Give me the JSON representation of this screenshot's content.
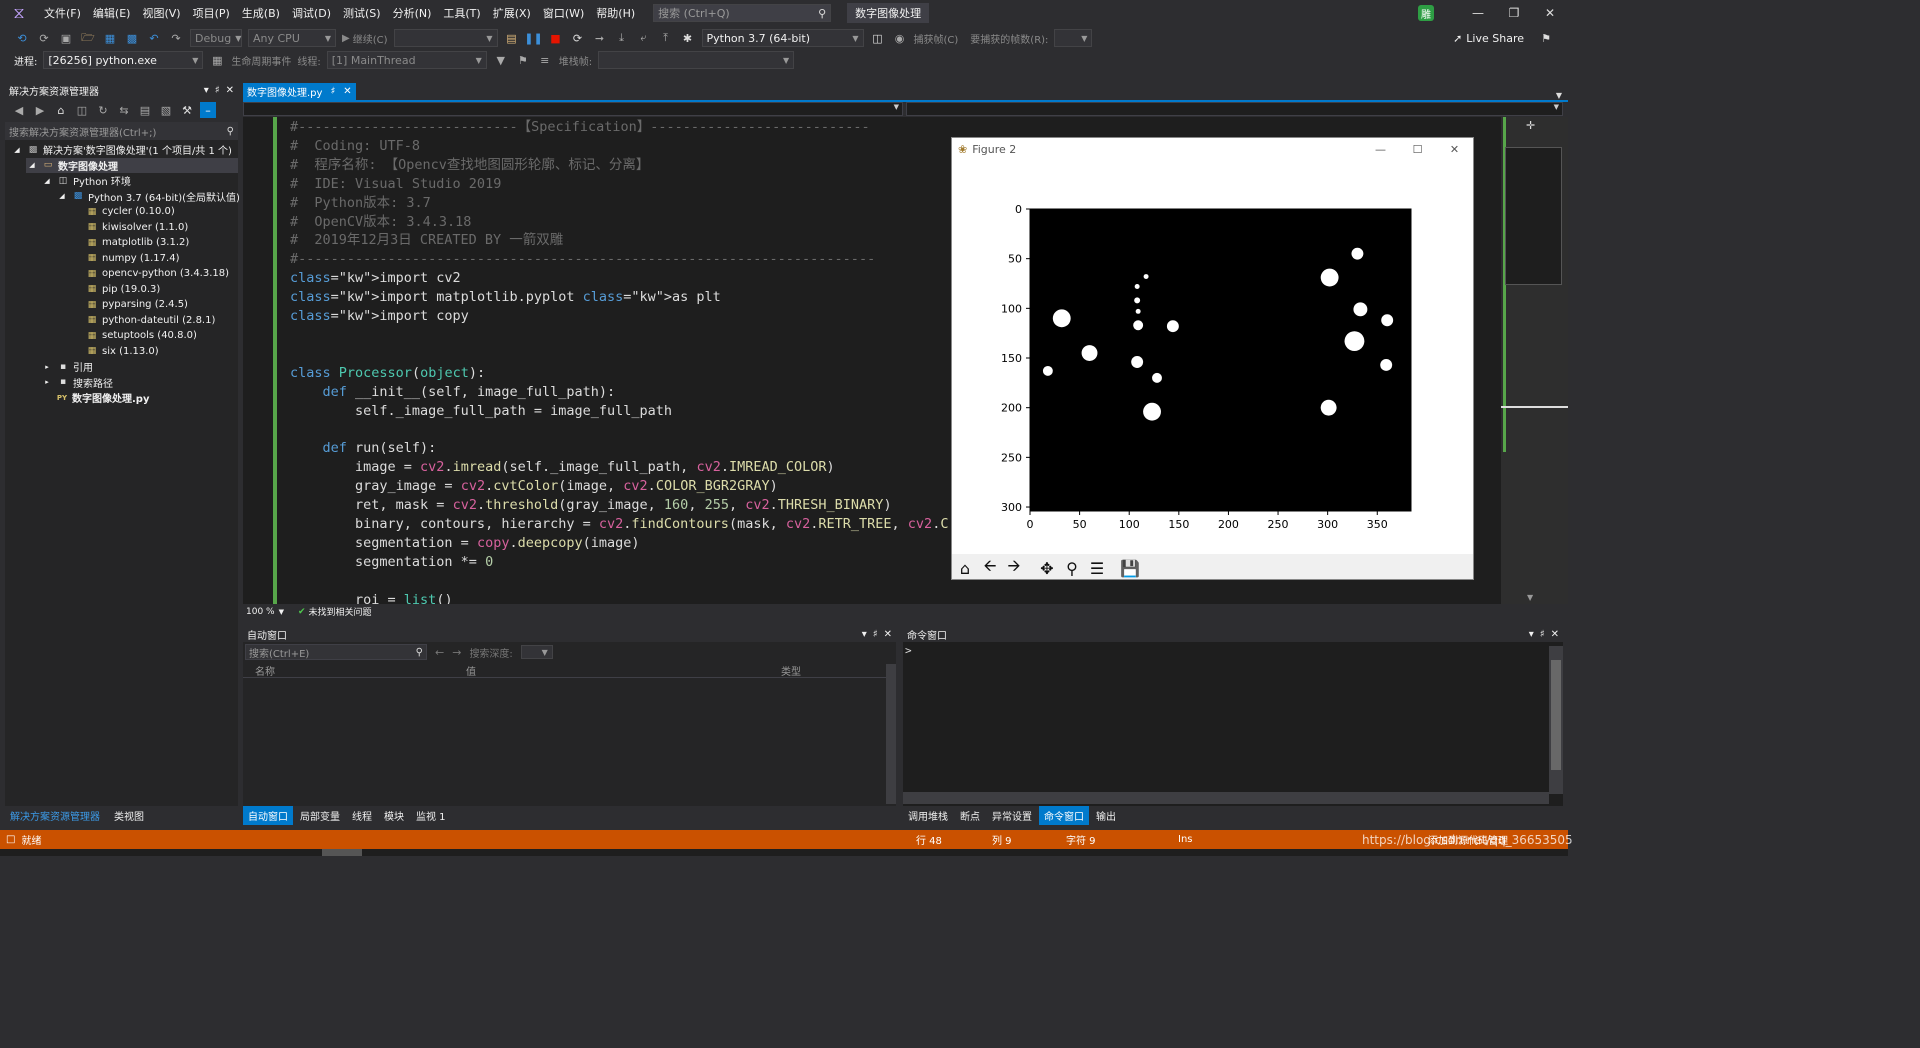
{
  "title_bar": {
    "menus": [
      "文件(F)",
      "编辑(E)",
      "视图(V)",
      "项目(P)",
      "生成(B)",
      "调试(D)",
      "测试(S)",
      "分析(N)",
      "工具(T)",
      "扩展(X)",
      "窗口(W)",
      "帮助(H)"
    ],
    "search_placeholder": "搜索 (Ctrl+Q)",
    "solution_name": "数字图像处理",
    "user_badge": "雕"
  },
  "toolbar1": {
    "config": "Debug",
    "platform": "Any CPU",
    "continue": "继续(C)",
    "python_env": "Python 3.7 (64-bit)",
    "capture": "捕获帧(C)",
    "frames_label": "要捕获的帧数(R):",
    "live_share": "Live Share"
  },
  "toolbar2": {
    "process_label": "进程:",
    "process_value": "[26256] python.exe",
    "lifecycle": "生命周期事件",
    "thread_label": "线程:",
    "thread_value": "[1] MainThread",
    "stack_label": "堆栈帧:"
  },
  "solution_explorer": {
    "title": "解决方案资源管理器",
    "search_placeholder": "搜索解决方案资源管理器(Ctrl+;)",
    "items": [
      {
        "label": "解决方案'数字图像处理'(1 个项目/共 1 个)",
        "icon": "solution-icon"
      },
      {
        "label": "数字图像处理",
        "icon": "python-project-icon"
      },
      {
        "label": "Python 环境",
        "icon": "environment-icon"
      },
      {
        "label": "Python 3.7 (64-bit)(全局默认值)",
        "icon": "python-env-icon"
      },
      {
        "label": "cycler (0.10.0)",
        "icon": "package-icon"
      },
      {
        "label": "kiwisolver (1.1.0)",
        "icon": "package-icon"
      },
      {
        "label": "matplotlib (3.1.2)",
        "icon": "package-icon"
      },
      {
        "label": "numpy (1.17.4)",
        "icon": "package-icon"
      },
      {
        "label": "opencv-python (3.4.3.18)",
        "icon": "package-icon"
      },
      {
        "label": "pip (19.0.3)",
        "icon": "package-icon"
      },
      {
        "label": "pyparsing (2.4.5)",
        "icon": "package-icon"
      },
      {
        "label": "python-dateutil (2.8.1)",
        "icon": "package-icon"
      },
      {
        "label": "setuptools (40.8.0)",
        "icon": "package-icon"
      },
      {
        "label": "six (1.13.0)",
        "icon": "package-icon"
      },
      {
        "label": "引用",
        "icon": "reference-icon"
      },
      {
        "label": "搜索路径",
        "icon": "search-path-icon"
      },
      {
        "label": "数字图像处理.py",
        "icon": "python-file-icon"
      }
    ],
    "bottom_tabs": [
      "解决方案资源管理器",
      "类视图"
    ]
  },
  "editor": {
    "tab_label": "数字图像处理.py",
    "zoom": "100 %",
    "issues": "未找到相关问题"
  },
  "code_lines": [
    "#---------------------------【Specification】---------------------------",
    "#  Coding: UTF-8",
    "#  程序名称: 【Opencv查找地图圆形轮廓、标记、分离】",
    "#  IDE: Visual Studio 2019",
    "#  Python版本: 3.7",
    "#  OpenCV版本: 3.4.3.18",
    "#  2019年12月3日 CREATED BY 一箭双雕",
    "#-----------------------------------------------------------------------",
    "import cv2",
    "import matplotlib.pyplot as plt",
    "import copy",
    "",
    "",
    "class Processor(object):",
    "    def __init__(self, image_full_path):",
    "        self._image_full_path = image_full_path",
    "",
    "    def run(self):",
    "        image = cv2.imread(self._image_full_path, cv2.IMREAD_COLOR)",
    "        gray_image = cv2.cvtColor(image, cv2.COLOR_BGR2GRAY)",
    "        ret, mask = cv2.threshold(gray_image, 160, 255, cv2.THRESH_BINARY)",
    "        binary, contours, hierarchy = cv2.findContours(mask, cv2.RETR_TREE, cv2.C",
    "        segmentation = copy.deepcopy(image)",
    "        segmentation *= 0",
    "",
    "        roi = list()"
  ],
  "figure": {
    "title": "Figure 2",
    "x_ticks": [
      "0",
      "50",
      "100",
      "150",
      "200",
      "250",
      "300",
      "350"
    ],
    "y_ticks": [
      "0",
      "50",
      "100",
      "150",
      "200",
      "250",
      "300"
    ]
  },
  "chart_data": {
    "type": "scatter",
    "title": "",
    "xlabel": "",
    "ylabel": "",
    "xlim": [
      0,
      384
    ],
    "ylim": [
      304,
      0
    ],
    "grid": false,
    "points": [
      {
        "x": 18,
        "y": 163,
        "r": 5
      },
      {
        "x": 32,
        "y": 110,
        "r": 9
      },
      {
        "x": 60,
        "y": 145,
        "r": 8
      },
      {
        "x": 108,
        "y": 78,
        "r": 2.5
      },
      {
        "x": 117,
        "y": 68,
        "r": 2.5
      },
      {
        "x": 108,
        "y": 92,
        "r": 3
      },
      {
        "x": 109,
        "y": 103,
        "r": 2.5
      },
      {
        "x": 109,
        "y": 117,
        "r": 5
      },
      {
        "x": 144,
        "y": 118,
        "r": 6
      },
      {
        "x": 108,
        "y": 154,
        "r": 6
      },
      {
        "x": 128,
        "y": 170,
        "r": 5
      },
      {
        "x": 123,
        "y": 204,
        "r": 9
      },
      {
        "x": 330,
        "y": 45,
        "r": 6
      },
      {
        "x": 302,
        "y": 69,
        "r": 9
      },
      {
        "x": 333,
        "y": 101,
        "r": 7
      },
      {
        "x": 360,
        "y": 112,
        "r": 6
      },
      {
        "x": 327,
        "y": 133,
        "r": 10
      },
      {
        "x": 359,
        "y": 157,
        "r": 6
      },
      {
        "x": 301,
        "y": 200,
        "r": 8
      }
    ]
  },
  "auto_window": {
    "title": "自动窗口",
    "search_placeholder": "搜索(Ctrl+E)",
    "depth_label": "搜索深度:",
    "columns": [
      "名称",
      "值",
      "类型"
    ]
  },
  "command_window": {
    "title": "命令窗口",
    "prompt": ">"
  },
  "bottom_left_tabs": [
    "自动窗口",
    "局部变量",
    "线程",
    "模块",
    "监视 1"
  ],
  "bottom_right_tabs": [
    "调用堆栈",
    "断点",
    "异常设置",
    "命令窗口",
    "输出"
  ],
  "status_bar": {
    "ready": "就绪",
    "line": "行 48",
    "col": "列 9",
    "char": "字符 9",
    "ins": "Ins",
    "source_control": "添加到源代码管理",
    "watermark": "https://blog.csdn.net/qq_36653505"
  },
  "colors": {
    "accent": "#007acc",
    "status_bar": "#ca5100",
    "editor_bg": "#1e1e1e"
  }
}
